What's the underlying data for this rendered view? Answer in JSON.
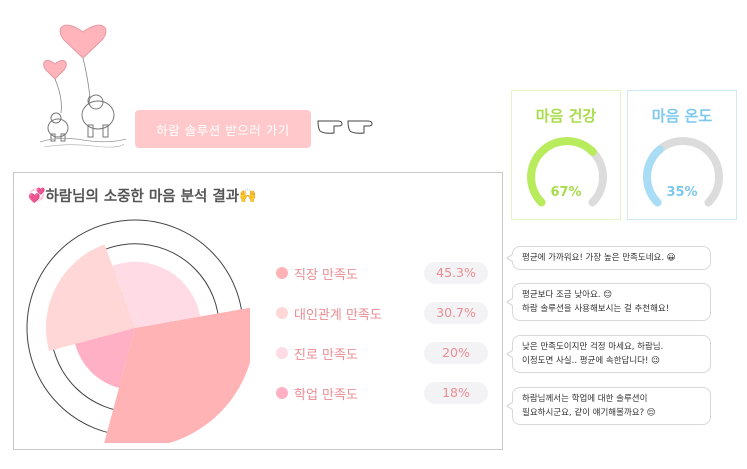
{
  "header": {
    "solution_button_label": "하람 솔루션 받으러 가기"
  },
  "gauges": [
    {
      "title": "마음 건강",
      "value_label": "67%",
      "value": 0.67,
      "color": "#b8ec5c",
      "track_color": "#dcdcdc"
    },
    {
      "title": "마음 온도",
      "value_label": "35%",
      "value": 0.35,
      "color": "#a9dcf5",
      "track_color": "#dcdcdc"
    }
  ],
  "analysis": {
    "title": "하람님의 소중한 마음 분석 결과",
    "title_prefix_emoji": "💞",
    "title_suffix_emoji": "🙌",
    "legend": [
      {
        "label": "직장 만족도",
        "value_label": "45.3%",
        "color": "#ffb3b5"
      },
      {
        "label": "대인관계 만족도",
        "value_label": "30.7%",
        "color": "#ffd7d7"
      },
      {
        "label": "진로 만족도",
        "value_label": "20%",
        "color": "#ffdbe6"
      },
      {
        "label": "학업 만족도",
        "value_label": "18%",
        "color": "#ffb0c4"
      }
    ]
  },
  "chart_data": {
    "type": "pie",
    "variant": "rose",
    "categories": [
      "직장 만족도",
      "대인관계 만족도",
      "진로 만족도",
      "학업 만족도"
    ],
    "values": [
      45.3,
      30.7,
      20,
      18
    ],
    "colors": [
      "#ffb3b5",
      "#ffd7d7",
      "#ffdbe6",
      "#ffb0c4"
    ],
    "grid": true
  },
  "comments": [
    {
      "lines": [
        "평균에 가까워요! 가장 높은 만족도네요. 😀"
      ]
    },
    {
      "lines": [
        "평균보다 조금 낮아요. 😊",
        "하람 솔루션을 사용해보시는 걸 추천해요!"
      ]
    },
    {
      "lines": [
        "낮은 만족도이지만 걱정 마세요, 하람님.",
        "이정도면 사실.. 평균에 속한답니다! 😉"
      ]
    },
    {
      "lines": [
        "하람님께서는 학업에 대한 솔루션이",
        "필요하시군요, 같이 얘기해볼까요? 😌"
      ]
    }
  ]
}
